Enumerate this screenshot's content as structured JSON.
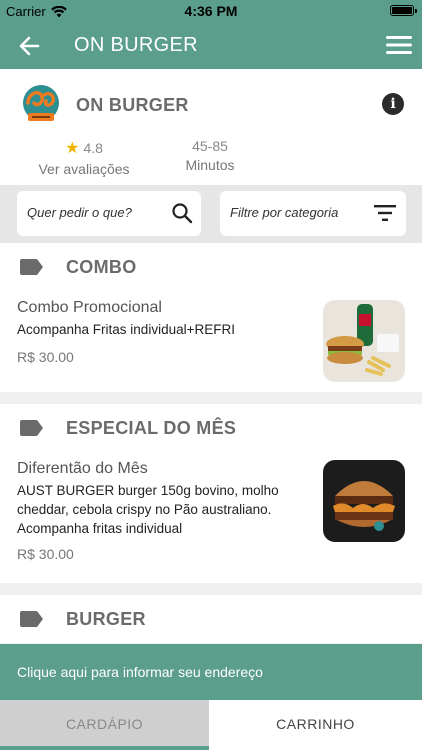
{
  "status_bar": {
    "carrier": "Carrier",
    "time": "4:36 PM"
  },
  "nav": {
    "title": "ON BURGER"
  },
  "store": {
    "name": "ON BURGER",
    "rating": "4.8",
    "rating_link": "Ver avaliações",
    "eta_range": "45-85",
    "eta_unit": "Minutos"
  },
  "filters": {
    "search_placeholder": "Quer pedir o que?",
    "category_placeholder": "Filtre por categoria"
  },
  "sections": [
    {
      "title": "COMBO",
      "products": [
        {
          "name": "Combo Promocional",
          "description": "Acompanha Fritas individual+REFRI",
          "price": "R$ 30.00"
        }
      ]
    },
    {
      "title": "ESPECIAL DO MÊS",
      "products": [
        {
          "name": "Diferentão do Mês",
          "description": "AUST BURGER burger 150g bovino, molho cheddar, cebola crispy no Pão australiano. Acompanha fritas individual",
          "price": "R$ 30.00"
        }
      ]
    },
    {
      "title": "BURGER",
      "products": []
    }
  ],
  "address_bar": {
    "text": "Clique aqui para informar seu endereço"
  },
  "tabs": {
    "menu": "CARDÁPIO",
    "cart": "CARRINHO"
  },
  "colors": {
    "primary": "#5b9e8b",
    "star": "#f0b400"
  },
  "icons": [
    "wifi-icon",
    "battery-icon",
    "back-arrow-icon",
    "hamburger-menu-icon",
    "store-logo",
    "info-icon",
    "star-icon",
    "search-icon",
    "filter-icon",
    "tag-icon"
  ]
}
